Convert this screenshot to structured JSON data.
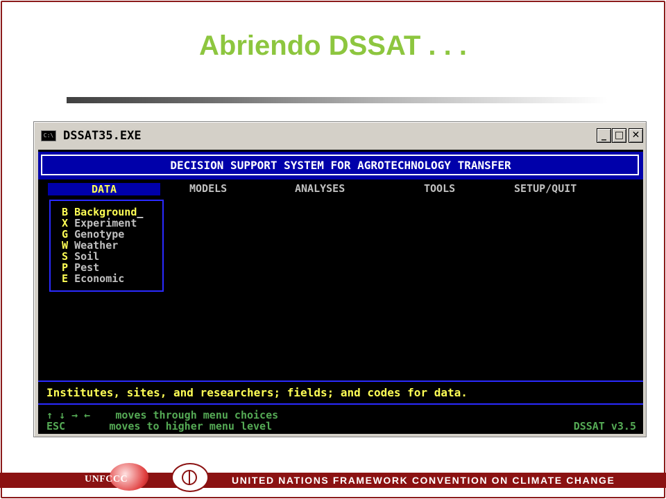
{
  "slide": {
    "title": "Abriendo DSSAT . . ."
  },
  "window": {
    "title": "DSSAT35.EXE",
    "icon_text": "C:\\",
    "controls": {
      "minimize": "_",
      "maximize": "□",
      "close": "✕"
    }
  },
  "console": {
    "header": "DECISION SUPPORT SYSTEM FOR AGROTECHNOLOGY TRANSFER",
    "menu": [
      "DATA",
      "MODELS",
      "ANALYSES",
      "TOOLS",
      "SETUP/QUIT"
    ],
    "active_menu": "DATA",
    "submenu": [
      {
        "key": "B",
        "label": "Background"
      },
      {
        "key": "X",
        "label": "Experiment"
      },
      {
        "key": "G",
        "label": "Genotype"
      },
      {
        "key": "W",
        "label": "Weather"
      },
      {
        "key": "S",
        "label": "Soil"
      },
      {
        "key": "P",
        "label": "Pest"
      },
      {
        "key": "E",
        "label": "Economic"
      }
    ],
    "selected_submenu": "Background",
    "cursor": "_",
    "help_text": "Institutes, sites, and researchers; fields; and codes for data.",
    "footer": {
      "line1_keys": "↑ ↓ → ←",
      "line1_text": "moves through menu choices",
      "line2_keys": "ESC",
      "line2_text": "moves to higher menu level",
      "version": "DSSAT v3.5"
    }
  },
  "footer": {
    "logo_text": "UNFCCC",
    "banner": "UNITED NATIONS FRAMEWORK CONVENTION ON CLIMATE CHANGE"
  },
  "colors": {
    "title": "#8dc63f",
    "console_bg": "#000000",
    "console_blue": "#0000aa",
    "highlight": "#ffff55",
    "menu_text": "#c0c0c0",
    "footer_green": "#55aa55",
    "footer_bar": "#8b1212"
  }
}
